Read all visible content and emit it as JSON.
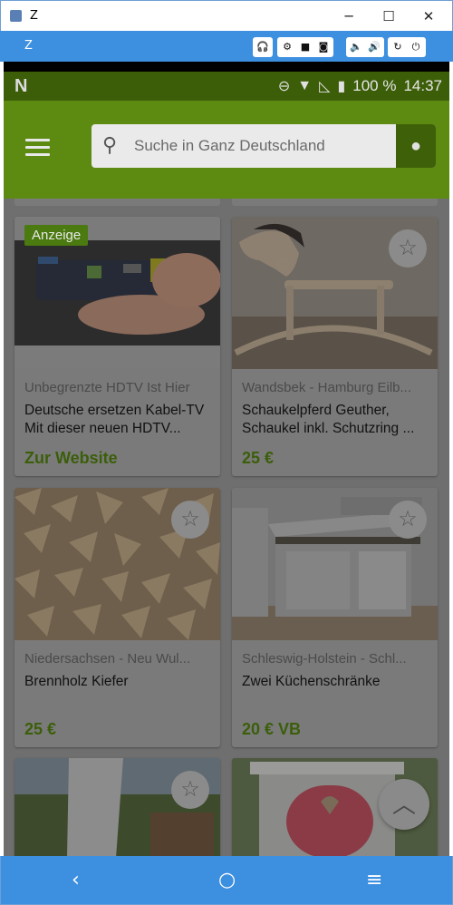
{
  "window": {
    "title": "Z",
    "minimize": "─",
    "maximize": "☐",
    "close": "✕"
  },
  "toolbar": {
    "label": "Z"
  },
  "statusbar": {
    "app_icon": "N",
    "battery": "100 %",
    "time": "14:37"
  },
  "appbar": {
    "search_placeholder": "Suche in Ganz Deutschland"
  },
  "cards": [
    {
      "badge": "Anzeige",
      "location": "Unbegrenzte HDTV Ist Hier",
      "title": "Deutsche ersetzen Kabel-TV Mit dieser neuen HDTV...",
      "price": "Zur Website"
    },
    {
      "location": "Wandsbek - Hamburg Eilb...",
      "title": "Schaukelpferd Geuther, Schaukel inkl. Schutzring ...",
      "price": "25 €"
    },
    {
      "location": "Niedersachsen - Neu Wul...",
      "title": "Brennholz Kiefer",
      "price": "25 €"
    },
    {
      "location": "Schleswig-Holstein - Schl...",
      "title": "Zwei Küchenschränke",
      "price": "20 € VB"
    }
  ],
  "navbar": {
    "back": "‹",
    "home": "○",
    "menu": "≡"
  },
  "colors": {
    "toolbar": "#3d8fe0",
    "appbar": "#5d8b12",
    "price": "#3b5e0a"
  }
}
